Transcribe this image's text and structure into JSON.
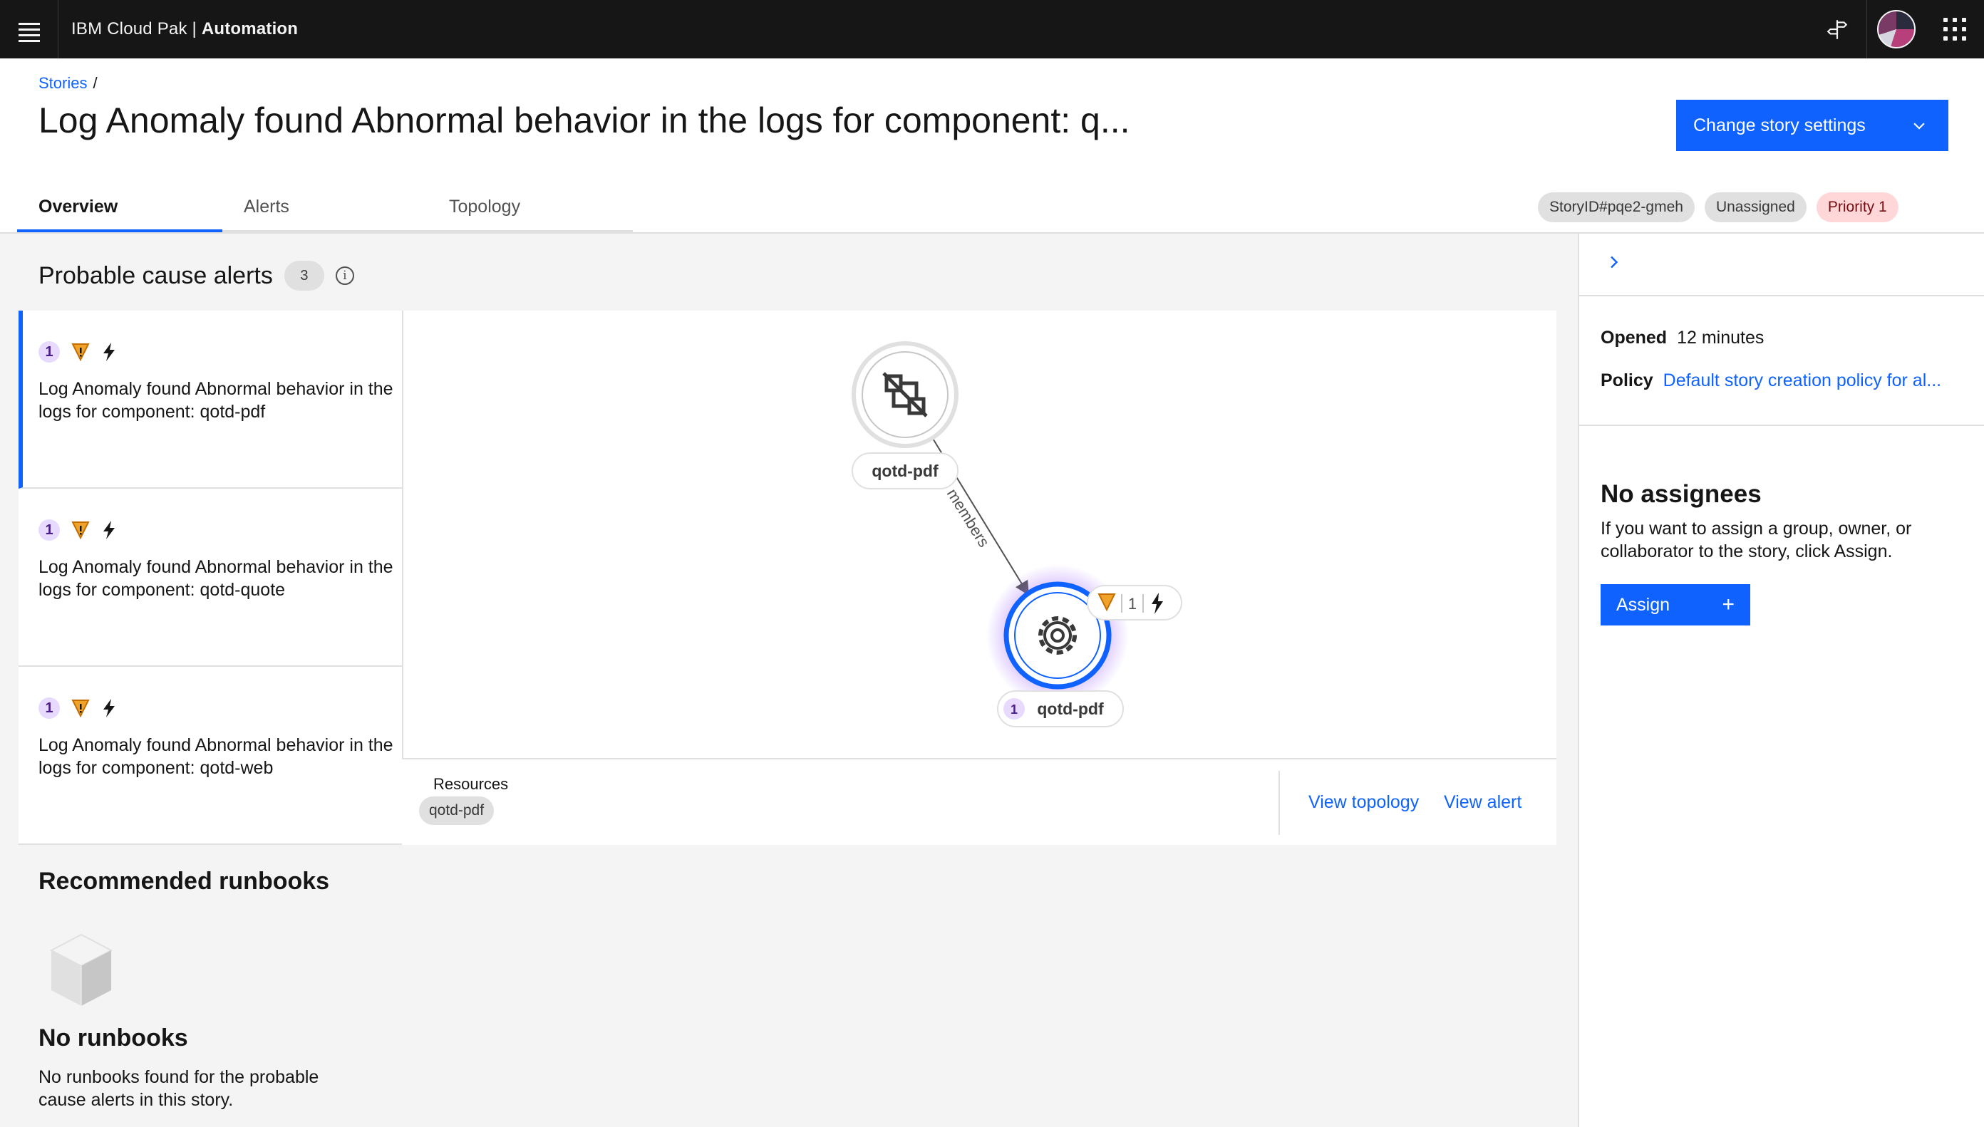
{
  "header": {
    "brand_prefix": "IBM Cloud Pak",
    "brand_separator": " | ",
    "brand_product": "Automation"
  },
  "breadcrumb": {
    "stories": "Stories",
    "separator": "/"
  },
  "page": {
    "title": "Log Anomaly found Abnormal behavior in the logs for component: q...",
    "change_settings_label": "Change story settings"
  },
  "tabs": [
    {
      "label": "Overview",
      "active": true
    },
    {
      "label": "Alerts",
      "active": false
    },
    {
      "label": "Topology",
      "active": false
    }
  ],
  "tags": {
    "story_id": "StoryID#pqe2-gmeh",
    "assignment": "Unassigned",
    "priority": "Priority 1"
  },
  "probable_cause": {
    "title": "Probable cause alerts",
    "count": "3",
    "alerts": [
      {
        "severity": "1",
        "text": "Log Anomaly found Abnormal behavior in the logs for component: qotd-pdf",
        "selected": true
      },
      {
        "severity": "1",
        "text": "Log Anomaly found Abnormal behavior in the logs for component: qotd-quote",
        "selected": false
      },
      {
        "severity": "1",
        "text": "Log Anomaly found Abnormal behavior in the logs for component: qotd-web",
        "selected": false
      }
    ]
  },
  "topology": {
    "source_node_label": "qotd-pdf",
    "edge_label": "members",
    "target_node_label": "qotd-pdf",
    "target_node_count": "1",
    "target_badge_count": "1"
  },
  "resources": {
    "label": "Resources",
    "items": [
      "qotd-pdf"
    ],
    "view_topology": "View topology",
    "view_alert": "View alert"
  },
  "runbooks": {
    "title": "Recommended runbooks",
    "empty_title": "No runbooks",
    "empty_text": "No runbooks found for the probable cause alerts in this story."
  },
  "side_panel": {
    "opened_label": "Opened",
    "opened_value": "12 minutes",
    "policy_label": "Policy",
    "policy_value": "Default story creation policy for al...",
    "no_assignees_title": "No assignees",
    "no_assignees_text": "If you want to assign a group, owner, or collaborator to the story, click Assign.",
    "assign_label": "Assign"
  },
  "colors": {
    "primary": "#0f62fe",
    "warning": "#f1c21b",
    "warning_orange": "#ff832b",
    "header_bg": "#161616",
    "severity_purple": "#e8daff"
  },
  "icons": {
    "menu": "hamburger-icon",
    "switcher": "app-switcher-icon",
    "signpost": "signpost-icon"
  }
}
